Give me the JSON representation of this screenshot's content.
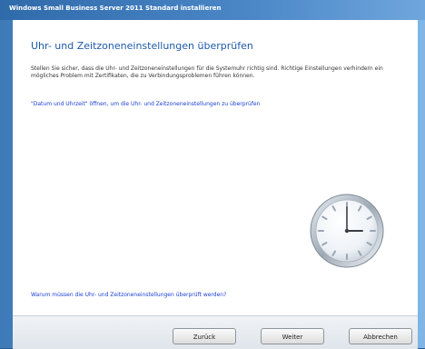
{
  "window": {
    "title": "Windows Small Business Server 2011 Standard installieren"
  },
  "content": {
    "heading": "Uhr- und Zeitzoneneinstellungen überprüfen",
    "description": "Stellen Sie sicher, dass die Uhr- und Zeitzoneneinstellungen für die Systemuhr richtig sind. Richtige Einstellungen verhindern ein mögliches Problem mit Zertifikaten, die zu Verbindungsproblemen führen können.",
    "datetime_link": "\"Datum und Uhrzeit\" öffnen, um die Uhr- und Zeitzoneneinstellungen zu überprüfen",
    "why_link": "Warum müssen die Uhr- und Zeitzoneneinstellungen überprüft werden?"
  },
  "buttons": {
    "back": "Zurück",
    "next": "Weiter",
    "cancel": "Abbrechen"
  },
  "clock": {
    "hour": 3,
    "minute": 0
  }
}
